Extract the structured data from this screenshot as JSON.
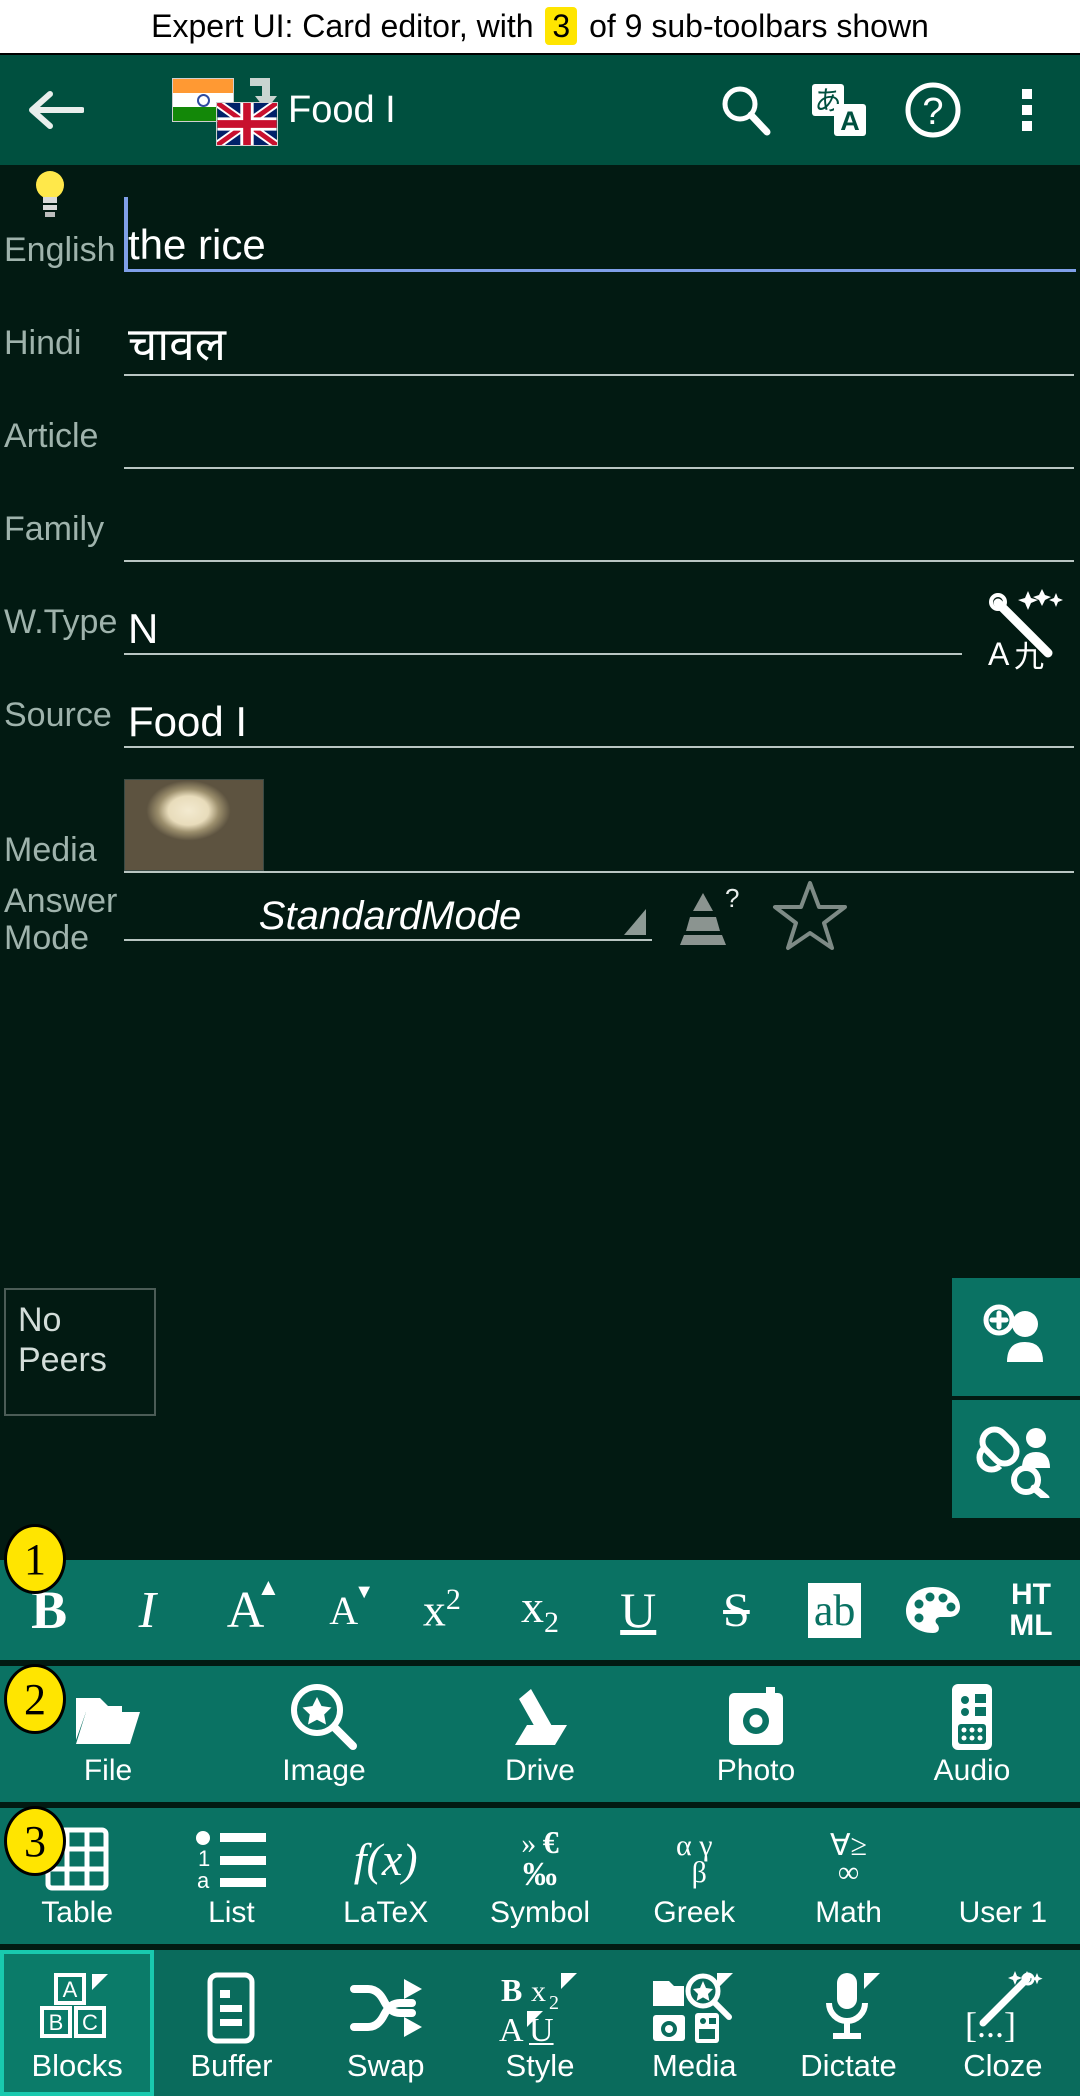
{
  "caption": {
    "before": "Expert UI: Card editor, with ",
    "highlight": "3",
    "after": " of 9 sub-toolbars shown"
  },
  "appbar": {
    "back_icon": "back-arrow-icon",
    "flag_source": "india-flag-icon",
    "flag_target": "uk-flag-icon",
    "swap_icon": "arrow-down-icon",
    "title": "Food I",
    "actions": [
      {
        "name": "search-icon",
        "label": "Search"
      },
      {
        "name": "translate-icon",
        "label": "Translate"
      },
      {
        "name": "help-icon",
        "label": "Help"
      },
      {
        "name": "overflow-menu-icon",
        "label": "More options"
      }
    ]
  },
  "form": {
    "fields": [
      {
        "label": "English",
        "value": "the rice",
        "focused": true,
        "hint_icon": "lightbulb-icon"
      },
      {
        "label": "Hindi",
        "value": "चावल",
        "focused": false
      },
      {
        "label": "Article",
        "value": "",
        "focused": false
      },
      {
        "label": "Family",
        "value": "",
        "focused": false
      },
      {
        "label": "W.Type",
        "value": "N",
        "focused": false,
        "trailing_icon": "magic-wand-transliterate-icon"
      },
      {
        "label": "Source",
        "value": "Food I",
        "focused": false
      },
      {
        "label": "Media",
        "value": "",
        "focused": false,
        "thumbnail": "rice-bowl-thumbnail"
      }
    ],
    "answer_mode": {
      "label_line1": "Answer",
      "label_line2": "Mode",
      "value": "StandardMode",
      "level_icon": "pyramid-level-icon",
      "favourite_icon": "star-outline-icon"
    },
    "peers": {
      "line1": "No",
      "line2": "Peers"
    },
    "side_buttons": [
      {
        "name": "add-peer-button",
        "icon": "person-plus-icon"
      },
      {
        "name": "link-peer-search-button",
        "icon": "person-link-search-icon"
      }
    ]
  },
  "toolbars": {
    "badges": [
      "1",
      "2",
      "3"
    ],
    "format_row": [
      {
        "name": "bold-button",
        "glyph": "B"
      },
      {
        "name": "italic-button",
        "glyph": "I"
      },
      {
        "name": "font-size-up-button",
        "glyph": "A"
      },
      {
        "name": "font-size-down-button",
        "glyph": "A"
      },
      {
        "name": "superscript-button",
        "glyph": "x"
      },
      {
        "name": "subscript-button",
        "glyph": "x"
      },
      {
        "name": "underline-button",
        "glyph": "U"
      },
      {
        "name": "strikethrough-button",
        "glyph": "S"
      },
      {
        "name": "highlight-button",
        "glyph": "ab"
      },
      {
        "name": "text-colour-button",
        "glyph": "palette-icon"
      },
      {
        "name": "html-button",
        "glyph": "HTML"
      }
    ],
    "insert_row": [
      {
        "name": "file-button",
        "label": "File",
        "icon": "folder-icon"
      },
      {
        "name": "image-button",
        "label": "Image",
        "icon": "image-search-icon"
      },
      {
        "name": "drive-button",
        "label": "Drive",
        "icon": "drive-icon"
      },
      {
        "name": "photo-button",
        "label": "Photo",
        "icon": "camera-icon"
      },
      {
        "name": "audio-button",
        "label": "Audio",
        "icon": "recorder-icon"
      }
    ],
    "symbol_row": [
      {
        "name": "table-button",
        "label": "Table",
        "icon": "table-grid-icon"
      },
      {
        "name": "list-button",
        "label": "List",
        "icon": "ordered-list-icon"
      },
      {
        "name": "latex-button",
        "label": "LaTeX",
        "icon": "function-icon"
      },
      {
        "name": "symbol-button",
        "label": "Symbol",
        "icon": "symbols-icon"
      },
      {
        "name": "greek-button",
        "label": "Greek",
        "icon": "greek-letters-icon"
      },
      {
        "name": "math-button",
        "label": "Math",
        "icon": "math-symbols-icon"
      },
      {
        "name": "user1-button",
        "label": "User 1",
        "icon": ""
      }
    ],
    "main_row": [
      {
        "name": "blocks-button",
        "label": "Blocks",
        "icon": "abc-blocks-icon",
        "selected": true
      },
      {
        "name": "buffer-button",
        "label": "Buffer",
        "icon": "document-icon",
        "selected": false
      },
      {
        "name": "swap-button",
        "label": "Swap",
        "icon": "shuffle-icon",
        "selected": false
      },
      {
        "name": "style-button",
        "label": "Style",
        "icon": "text-style-icon",
        "selected": false
      },
      {
        "name": "media-button",
        "label": "Media",
        "icon": "media-group-icon",
        "selected": false
      },
      {
        "name": "dictate-button",
        "label": "Dictate",
        "icon": "microphone-icon",
        "selected": false
      },
      {
        "name": "cloze-button",
        "label": "Cloze",
        "icon": "cloze-brackets-icon",
        "selected": false
      }
    ]
  },
  "colors": {
    "appbar": "#00503f",
    "body": "#021a12",
    "toolbar": "#0a7263",
    "accent_focus": "#7f9fe8",
    "badge": "#ffe500",
    "selected_outline": "#19c9ae",
    "label_text": "#9fb3ac"
  }
}
